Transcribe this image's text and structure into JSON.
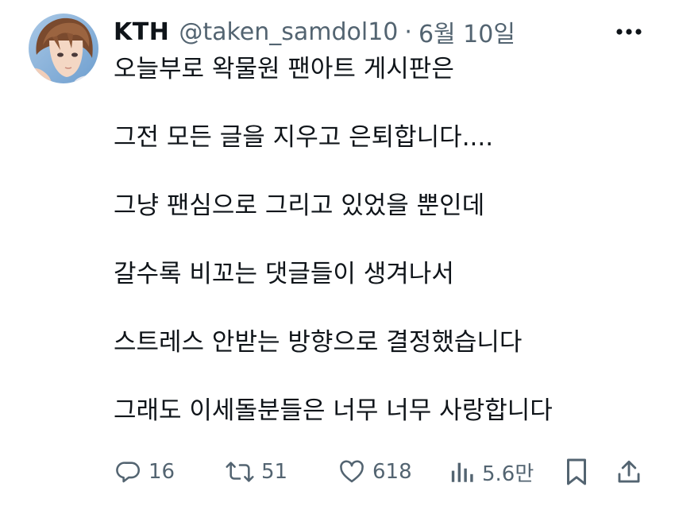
{
  "author": {
    "display_name": "KTH",
    "handle": "@taken_samdol10",
    "separator": "·",
    "timestamp": "6월 10일"
  },
  "tweet": {
    "lines": [
      "오늘부로 왁물원 팬아트 게시판은",
      "그전 모든 글을 지우고 은퇴합니다....",
      "그냥 팬심으로 그리고 있었을 뿐인데",
      "갈수록 비꼬는 댓글들이 생겨나서",
      "스트레스 안받는 방향으로 결정했습니다",
      "그래도 이세돌분들은 너무 너무 사랑합니다"
    ]
  },
  "actions": {
    "reply_count": "16",
    "retweet_count": "51",
    "like_count": "618",
    "views_count": "5.6만"
  },
  "icons": {
    "more": "more-horizontal-icon",
    "reply": "reply-icon",
    "retweet": "retweet-icon",
    "like": "heart-icon",
    "views": "views-chart-icon",
    "bookmark": "bookmark-icon",
    "share": "share-icon"
  },
  "colors": {
    "text_primary": "#0f1419",
    "text_secondary": "#536471",
    "background": "#ffffff"
  }
}
